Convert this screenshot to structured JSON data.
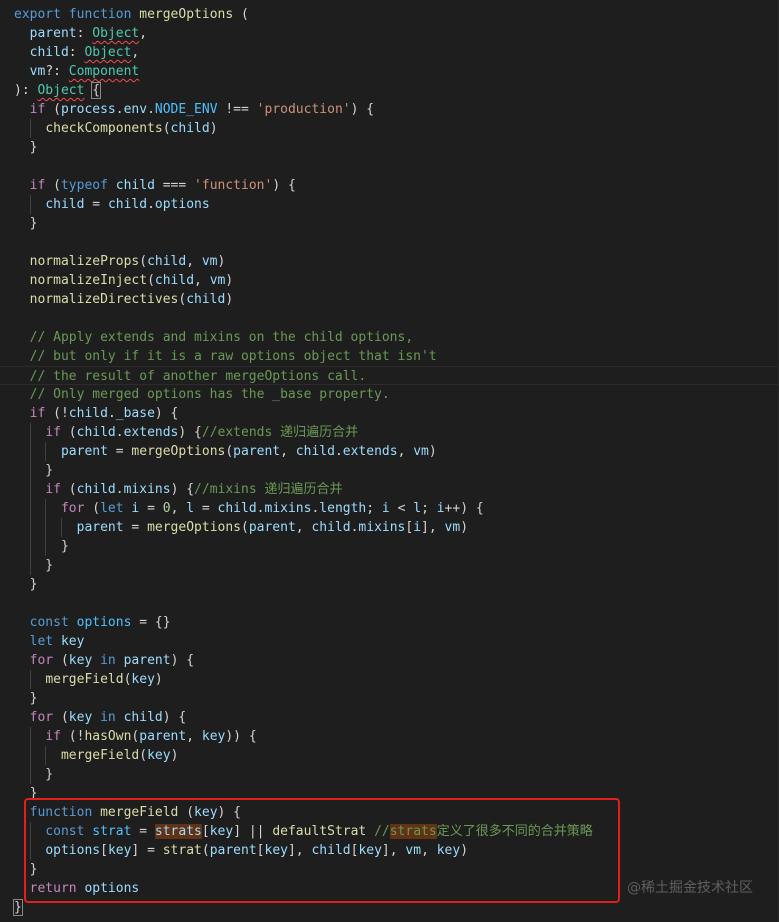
{
  "editor": {
    "language": "javascript",
    "theme": "dark",
    "lines": [
      [
        [
          "kw",
          "export"
        ],
        [
          "pun",
          " "
        ],
        [
          "kw",
          "function"
        ],
        [
          "pun",
          " "
        ],
        [
          "fn",
          "mergeOptions"
        ],
        [
          "pun",
          " ("
        ]
      ],
      [
        [
          "pun",
          "  "
        ],
        [
          "var",
          "parent"
        ],
        [
          "pun",
          ": "
        ],
        [
          "typ sq",
          "Object"
        ],
        [
          "pun",
          ","
        ]
      ],
      [
        [
          "pun",
          "  "
        ],
        [
          "var",
          "child"
        ],
        [
          "pun",
          ": "
        ],
        [
          "typ sq",
          "Object"
        ],
        [
          "pun",
          ","
        ]
      ],
      [
        [
          "pun",
          "  "
        ],
        [
          "var",
          "vm"
        ],
        [
          "pun",
          "?: "
        ],
        [
          "typ sq",
          "Component"
        ]
      ],
      [
        [
          "pun",
          "): "
        ],
        [
          "typ sq",
          "Object"
        ],
        [
          "pun",
          " "
        ],
        [
          "pun bracket-box",
          "{"
        ]
      ],
      [
        [
          "pun",
          "  "
        ],
        [
          "ctl",
          "if"
        ],
        [
          "pun",
          " ("
        ],
        [
          "var",
          "process"
        ],
        [
          "pun",
          "."
        ],
        [
          "var",
          "env"
        ],
        [
          "pun",
          "."
        ],
        [
          "cst",
          "NODE_ENV"
        ],
        [
          "pun",
          " !== "
        ],
        [
          "str",
          "'production'"
        ],
        [
          "pun",
          ") {"
        ]
      ],
      [
        [
          "pun",
          "    "
        ],
        [
          "fn",
          "checkComponents"
        ],
        [
          "pun",
          "("
        ],
        [
          "var",
          "child"
        ],
        [
          "pun",
          ")"
        ]
      ],
      [
        [
          "pun",
          "  }"
        ]
      ],
      [],
      [
        [
          "pun",
          "  "
        ],
        [
          "ctl",
          "if"
        ],
        [
          "pun",
          " ("
        ],
        [
          "kw",
          "typeof"
        ],
        [
          "pun",
          " "
        ],
        [
          "var",
          "child"
        ],
        [
          "pun",
          " === "
        ],
        [
          "str",
          "'function'"
        ],
        [
          "pun",
          ") {"
        ]
      ],
      [
        [
          "pun",
          "    "
        ],
        [
          "var",
          "child"
        ],
        [
          "pun",
          " = "
        ],
        [
          "var",
          "child"
        ],
        [
          "pun",
          "."
        ],
        [
          "var",
          "options"
        ]
      ],
      [
        [
          "pun",
          "  }"
        ]
      ],
      [],
      [
        [
          "pun",
          "  "
        ],
        [
          "fn",
          "normalizeProps"
        ],
        [
          "pun",
          "("
        ],
        [
          "var",
          "child"
        ],
        [
          "pun",
          ", "
        ],
        [
          "var",
          "vm"
        ],
        [
          "pun",
          ")"
        ]
      ],
      [
        [
          "pun",
          "  "
        ],
        [
          "fn",
          "normalizeInject"
        ],
        [
          "pun",
          "("
        ],
        [
          "var",
          "child"
        ],
        [
          "pun",
          ", "
        ],
        [
          "var",
          "vm"
        ],
        [
          "pun",
          ")"
        ]
      ],
      [
        [
          "pun",
          "  "
        ],
        [
          "fn",
          "normalizeDirectives"
        ],
        [
          "pun",
          "("
        ],
        [
          "var",
          "child"
        ],
        [
          "pun",
          ")"
        ]
      ],
      [],
      [
        [
          "pun",
          "  "
        ],
        [
          "cmt",
          "// Apply extends and mixins on the child options,"
        ]
      ],
      [
        [
          "pun",
          "  "
        ],
        [
          "cmt",
          "// but only if it is a raw options object that isn't"
        ]
      ],
      [
        [
          "pun",
          "  "
        ],
        [
          "cmt",
          "// the result of another mergeOptions call."
        ]
      ],
      [
        [
          "pun",
          "  "
        ],
        [
          "cmt",
          "// Only merged options has the _base property."
        ]
      ],
      [
        [
          "pun",
          "  "
        ],
        [
          "ctl",
          "if"
        ],
        [
          "pun",
          " (!"
        ],
        [
          "var",
          "child"
        ],
        [
          "pun",
          "."
        ],
        [
          "var",
          "_base"
        ],
        [
          "pun",
          ") {"
        ]
      ],
      [
        [
          "pun",
          "    "
        ],
        [
          "ctl",
          "if"
        ],
        [
          "pun",
          " ("
        ],
        [
          "var",
          "child"
        ],
        [
          "pun",
          "."
        ],
        [
          "var",
          "extends"
        ],
        [
          "pun",
          ") {"
        ],
        [
          "cmt",
          "//extends 递归遍历合并"
        ]
      ],
      [
        [
          "pun",
          "      "
        ],
        [
          "var",
          "parent"
        ],
        [
          "pun",
          " = "
        ],
        [
          "fn",
          "mergeOptions"
        ],
        [
          "pun",
          "("
        ],
        [
          "var",
          "parent"
        ],
        [
          "pun",
          ", "
        ],
        [
          "var",
          "child"
        ],
        [
          "pun",
          "."
        ],
        [
          "var",
          "extends"
        ],
        [
          "pun",
          ", "
        ],
        [
          "var",
          "vm"
        ],
        [
          "pun",
          ")"
        ]
      ],
      [
        [
          "pun",
          "    }"
        ]
      ],
      [
        [
          "pun",
          "    "
        ],
        [
          "ctl",
          "if"
        ],
        [
          "pun",
          " ("
        ],
        [
          "var",
          "child"
        ],
        [
          "pun",
          "."
        ],
        [
          "var",
          "mixins"
        ],
        [
          "pun",
          ") {"
        ],
        [
          "cmt",
          "//mixins 递归遍历合并"
        ]
      ],
      [
        [
          "pun",
          "      "
        ],
        [
          "ctl",
          "for"
        ],
        [
          "pun",
          " ("
        ],
        [
          "kw",
          "let"
        ],
        [
          "pun",
          " "
        ],
        [
          "var",
          "i"
        ],
        [
          "pun",
          " = "
        ],
        [
          "num",
          "0"
        ],
        [
          "pun",
          ", "
        ],
        [
          "var",
          "l"
        ],
        [
          "pun",
          " = "
        ],
        [
          "var",
          "child"
        ],
        [
          "pun",
          "."
        ],
        [
          "var",
          "mixins"
        ],
        [
          "pun",
          "."
        ],
        [
          "var",
          "length"
        ],
        [
          "pun",
          "; "
        ],
        [
          "var",
          "i"
        ],
        [
          "pun",
          " < "
        ],
        [
          "var",
          "l"
        ],
        [
          "pun",
          "; "
        ],
        [
          "var",
          "i"
        ],
        [
          "pun",
          "++) {"
        ]
      ],
      [
        [
          "pun",
          "        "
        ],
        [
          "var",
          "parent"
        ],
        [
          "pun",
          " = "
        ],
        [
          "fn",
          "mergeOptions"
        ],
        [
          "pun",
          "("
        ],
        [
          "var",
          "parent"
        ],
        [
          "pun",
          ", "
        ],
        [
          "var",
          "child"
        ],
        [
          "pun",
          "."
        ],
        [
          "var",
          "mixins"
        ],
        [
          "pun",
          "["
        ],
        [
          "var",
          "i"
        ],
        [
          "pun",
          "], "
        ],
        [
          "var",
          "vm"
        ],
        [
          "pun",
          ")"
        ]
      ],
      [
        [
          "pun",
          "      }"
        ]
      ],
      [
        [
          "pun",
          "    }"
        ]
      ],
      [
        [
          "pun",
          "  }"
        ]
      ],
      [],
      [
        [
          "pun",
          "  "
        ],
        [
          "kw",
          "const"
        ],
        [
          "pun",
          " "
        ],
        [
          "cst",
          "options"
        ],
        [
          "pun",
          " = {}"
        ]
      ],
      [
        [
          "pun",
          "  "
        ],
        [
          "kw",
          "let"
        ],
        [
          "pun",
          " "
        ],
        [
          "var",
          "key"
        ]
      ],
      [
        [
          "pun",
          "  "
        ],
        [
          "ctl",
          "for"
        ],
        [
          "pun",
          " ("
        ],
        [
          "var",
          "key"
        ],
        [
          "pun",
          " "
        ],
        [
          "kw",
          "in"
        ],
        [
          "pun",
          " "
        ],
        [
          "var",
          "parent"
        ],
        [
          "pun",
          ") {"
        ]
      ],
      [
        [
          "pun",
          "    "
        ],
        [
          "fn",
          "mergeField"
        ],
        [
          "pun",
          "("
        ],
        [
          "var",
          "key"
        ],
        [
          "pun",
          ")"
        ]
      ],
      [
        [
          "pun",
          "  }"
        ]
      ],
      [
        [
          "pun",
          "  "
        ],
        [
          "ctl",
          "for"
        ],
        [
          "pun",
          " ("
        ],
        [
          "var",
          "key"
        ],
        [
          "pun",
          " "
        ],
        [
          "kw",
          "in"
        ],
        [
          "pun",
          " "
        ],
        [
          "var",
          "child"
        ],
        [
          "pun",
          ") {"
        ]
      ],
      [
        [
          "pun",
          "    "
        ],
        [
          "ctl",
          "if"
        ],
        [
          "pun",
          " (!"
        ],
        [
          "fn",
          "hasOwn"
        ],
        [
          "pun",
          "("
        ],
        [
          "var",
          "parent"
        ],
        [
          "pun",
          ", "
        ],
        [
          "var",
          "key"
        ],
        [
          "pun",
          ")) {"
        ]
      ],
      [
        [
          "pun",
          "      "
        ],
        [
          "fn",
          "mergeField"
        ],
        [
          "pun",
          "("
        ],
        [
          "var",
          "key"
        ],
        [
          "pun",
          ")"
        ]
      ],
      [
        [
          "pun",
          "    }"
        ]
      ],
      [
        [
          "pun",
          "  }"
        ]
      ],
      [
        [
          "pun",
          "  "
        ],
        [
          "kw",
          "function"
        ],
        [
          "pun",
          " "
        ],
        [
          "fn",
          "mergeField"
        ],
        [
          "pun",
          " ("
        ],
        [
          "var",
          "key"
        ],
        [
          "pun",
          ") {"
        ]
      ],
      [
        [
          "pun",
          "    "
        ],
        [
          "kw",
          "const"
        ],
        [
          "pun",
          " "
        ],
        [
          "cst",
          "strat"
        ],
        [
          "pun",
          " = "
        ],
        [
          "var hl",
          "strats"
        ],
        [
          "pun",
          "["
        ],
        [
          "var",
          "key"
        ],
        [
          "pun",
          "] || "
        ],
        [
          "fn",
          "defaultStrat"
        ],
        [
          "pun",
          " "
        ],
        [
          "cmt",
          "//"
        ],
        [
          "cmt hl",
          "strats"
        ],
        [
          "cmt",
          "定义了很多不同的合并策略"
        ]
      ],
      [
        [
          "pun",
          "    "
        ],
        [
          "var",
          "options"
        ],
        [
          "pun",
          "["
        ],
        [
          "var",
          "key"
        ],
        [
          "pun",
          "] = "
        ],
        [
          "fn",
          "strat"
        ],
        [
          "pun",
          "("
        ],
        [
          "var",
          "parent"
        ],
        [
          "pun",
          "["
        ],
        [
          "var",
          "key"
        ],
        [
          "pun",
          "], "
        ],
        [
          "var",
          "child"
        ],
        [
          "pun",
          "["
        ],
        [
          "var",
          "key"
        ],
        [
          "pun",
          "], "
        ],
        [
          "var",
          "vm"
        ],
        [
          "pun",
          ", "
        ],
        [
          "var",
          "key"
        ],
        [
          "pun",
          ")"
        ]
      ],
      [
        [
          "pun",
          "  }"
        ]
      ],
      [
        [
          "pun",
          "  "
        ],
        [
          "ctl",
          "return"
        ],
        [
          "pun",
          " "
        ],
        [
          "var",
          "options"
        ]
      ],
      [
        [
          "pun bracket-box",
          "}"
        ]
      ]
    ]
  },
  "watermark": "@稀土掘金技术社区",
  "colors": {
    "background": "#1e1e1e",
    "highlight_box": "#e0201c",
    "keyword": "#569cd6",
    "control": "#c586c0",
    "function": "#dcdcaa",
    "variable": "#9cdcfe",
    "type": "#4ec9b0",
    "string": "#ce9178",
    "comment": "#6a9955"
  }
}
